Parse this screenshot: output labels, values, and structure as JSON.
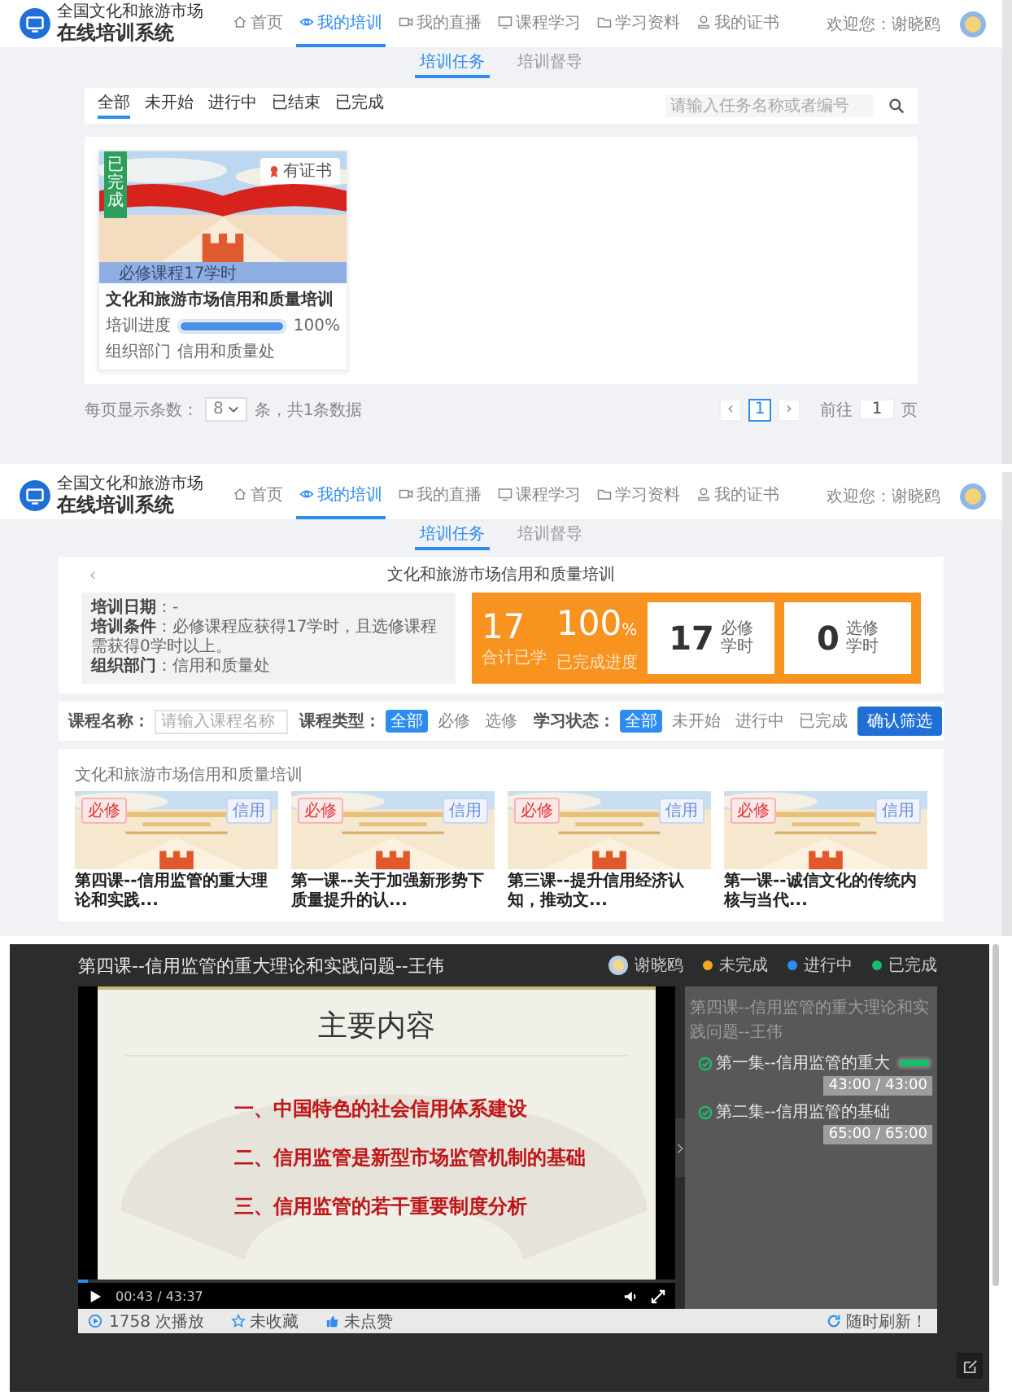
{
  "pages": [
    {
      "kind": "list",
      "header": {
        "logo_top": "全国文化和旅游市场",
        "logo_bottom": "在线培训系统",
        "nav": [
          {
            "kind": "home",
            "label": "首页",
            "selected": false
          },
          {
            "kind": "training",
            "label": "我的培训",
            "selected": true
          },
          {
            "kind": "live",
            "label": "我的直播",
            "selected": false
          },
          {
            "kind": "course",
            "label": "课程学习",
            "selected": false
          },
          {
            "kind": "material",
            "label": "学习资料",
            "selected": false
          },
          {
            "kind": "certificate",
            "label": "我的证书",
            "selected": false
          }
        ],
        "welcome": "欢迎您：谢晓鸥"
      },
      "subtabs": [
        {
          "label": "培训任务",
          "selected": true
        },
        {
          "label": "培训督导",
          "selected": false
        }
      ],
      "filters": [
        {
          "label": "全部",
          "selected": true
        },
        {
          "label": "未开始",
          "selected": false
        },
        {
          "label": "进行中",
          "selected": false
        },
        {
          "label": "已结束",
          "selected": false
        },
        {
          "label": "已完成",
          "selected": false
        }
      ],
      "search": {
        "placeholder": "请输入任务名称或者编号"
      },
      "trainings": [
        {
          "status": "已完成",
          "certificate": "有证书",
          "hours": "必修课程17学时",
          "title": "文化和旅游市场信用和质量培训",
          "progress_label": "培训进度",
          "level": 1,
          "progress_text": "100%",
          "dept_label": "组织部门",
          "dept": "信用和质量处"
        }
      ],
      "pagination": {
        "size_label": "每页显示条数：",
        "size": "8",
        "total": "条，共1条数据",
        "prev": "‹",
        "pages": [
          {
            "label": "1",
            "selected": true
          }
        ],
        "next": "›",
        "goto_prefix": "前往",
        "goto_value": "1",
        "goto_suffix": "页"
      }
    },
    {
      "kind": "detail",
      "header": {
        "logo_top": "全国文化和旅游市场",
        "logo_bottom": "在线培训系统",
        "nav": [
          {
            "kind": "home",
            "label": "首页",
            "selected": false
          },
          {
            "kind": "training",
            "label": "我的培训",
            "selected": true
          },
          {
            "kind": "live",
            "label": "我的直播",
            "selected": false
          },
          {
            "kind": "course",
            "label": "课程学习",
            "selected": false
          },
          {
            "kind": "material",
            "label": "学习资料",
            "selected": false
          },
          {
            "kind": "certificate",
            "label": "我的证书",
            "selected": false
          }
        ],
        "welcome": "欢迎您：谢晓鸥"
      },
      "subtabs": [
        {
          "label": "培训任务",
          "selected": true
        },
        {
          "label": "培训督导",
          "selected": false
        }
      ],
      "back": "‹",
      "title": "文化和旅游市场信用和质量培训",
      "info": [
        "**培训日期**：-",
        "**培训条件**：必修课程应获得17学时，且选修课程需获得0学时以上。",
        "**组织部门**：信用和质量处"
      ],
      "totals": [
        {
          "value": "17",
          "caption": "合计已学"
        },
        {
          "value": "100",
          "unit": "%",
          "caption": "已完成进度"
        }
      ],
      "hour_boxes": [
        {
          "value": "17",
          "type": "必修",
          "unit": "学时"
        },
        {
          "value": "0",
          "type": "选修",
          "unit": "学时"
        }
      ],
      "course_filter": {
        "name_label": "课程名称：",
        "name_placeholder": "请输入课程名称",
        "type_label": "课程类型：",
        "types": [
          {
            "label": "全部",
            "selected": true
          },
          {
            "label": "必修",
            "selected": false
          },
          {
            "label": "选修",
            "selected": false
          }
        ],
        "status_label": "学习状态：",
        "statuses": [
          {
            "label": "全部",
            "selected": true
          },
          {
            "label": "未开始",
            "selected": false
          },
          {
            "label": "进行中",
            "selected": false
          },
          {
            "label": "已完成",
            "selected": false
          }
        ],
        "confirm": "确认筛选"
      },
      "list_title": "文化和旅游市场信用和质量培训",
      "courses": [
        {
          "required": "必修",
          "tag": "信用",
          "title": "第四课--信用监管的重大理论和实践..."
        },
        {
          "required": "必修",
          "tag": "信用",
          "title": "第一课--关于加强新形势下质量提升的认..."
        },
        {
          "required": "必修",
          "tag": "信用",
          "title": "第三课--提升信用经济认知，推动文..."
        },
        {
          "required": "必修",
          "tag": "信用",
          "title": "第一课--诚信文化的传统内核与当代..."
        }
      ]
    },
    {
      "kind": "player",
      "title": "第四课--信用监管的重大理论和实践问题--王伟",
      "user": "谢晓鸥",
      "legend": [
        {
          "label": "未完成",
          "color": "#f5a623"
        },
        {
          "label": "进行中",
          "color": "#2d8cf0"
        },
        {
          "label": "已完成",
          "color": "#19be6b"
        }
      ],
      "slide": {
        "heading": "主要内容",
        "points": [
          "一、中国特色的社会信用体系建设",
          "二、信用监管是新型市场监管机制的基础",
          "三、信用监管的若干重要制度分析"
        ]
      },
      "video": {
        "level": 0.016,
        "time": "00:43 / 43:37"
      },
      "sidebar": {
        "title": "第四课--信用监管的重大理论和实践问题--王伟",
        "chapters": [
          {
            "title": "第一集--信用监管的重大",
            "done": true,
            "level": 1,
            "time": "43:00 / 43:00"
          },
          {
            "title": "第二集--信用监管的基础",
            "done": true,
            "time": "65:00 / 65:00"
          }
        ]
      },
      "stats": {
        "plays": "1758 次播放",
        "favorite": "未收藏",
        "like": "未点赞",
        "refresh": "随时刷新！"
      }
    }
  ]
}
